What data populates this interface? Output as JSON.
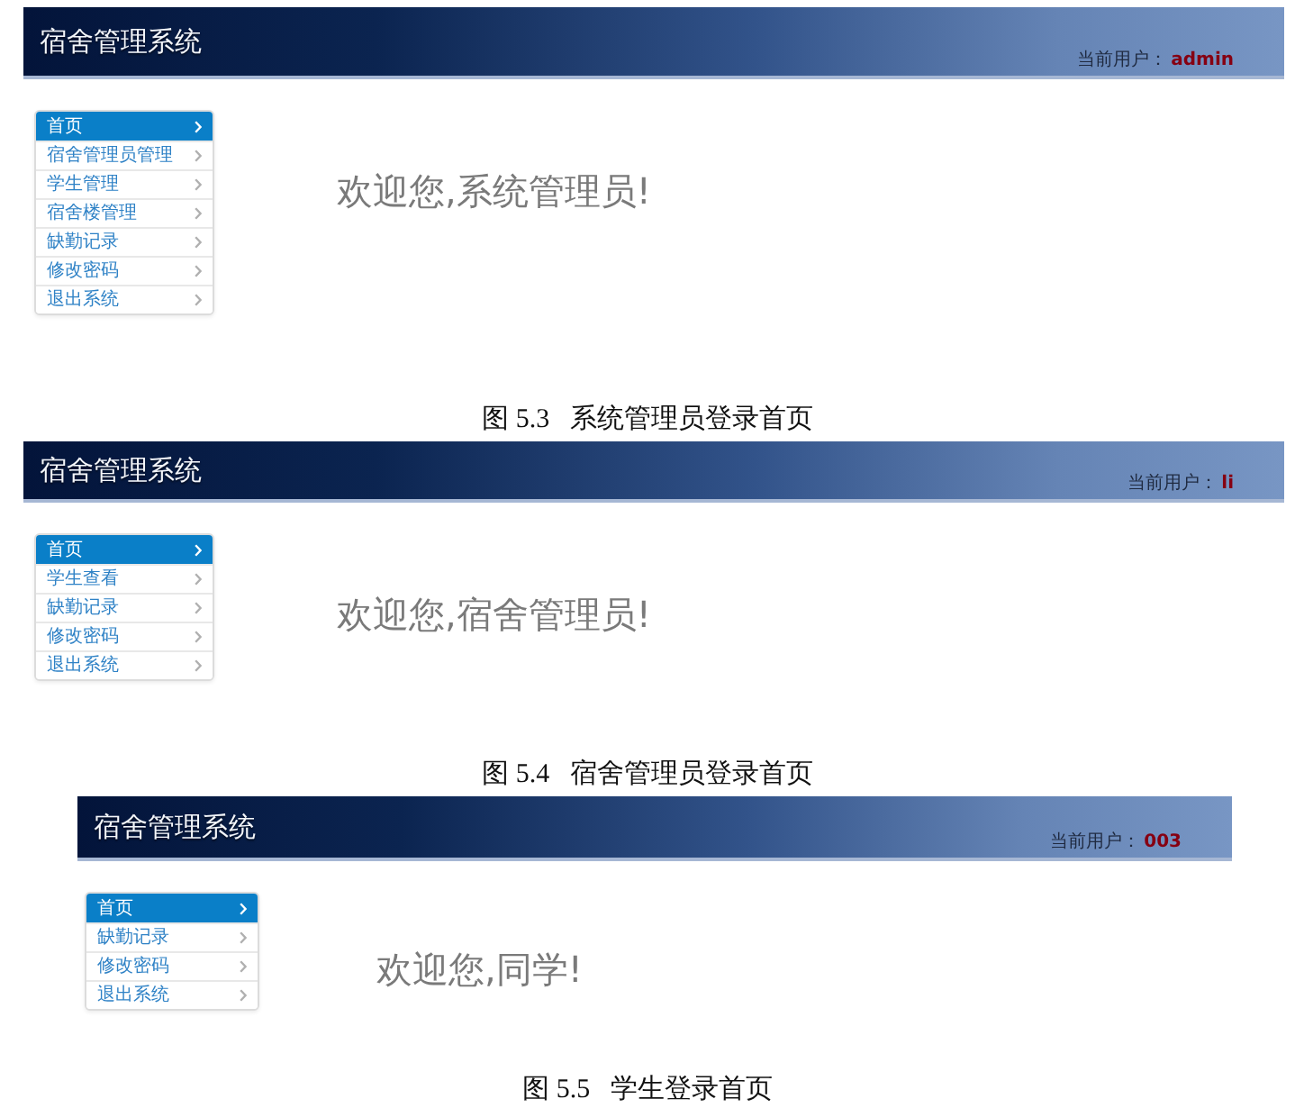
{
  "figures": [
    {
      "header": {
        "title": "宿舍管理系统",
        "user_label": "当前用户：",
        "user_name": "admin"
      },
      "menu": [
        {
          "label": "首页",
          "selected": true
        },
        {
          "label": "宿舍管理员管理",
          "selected": false
        },
        {
          "label": "学生管理",
          "selected": false
        },
        {
          "label": "宿舍楼管理",
          "selected": false
        },
        {
          "label": "缺勤记录",
          "selected": false
        },
        {
          "label": "修改密码",
          "selected": false
        },
        {
          "label": "退出系统",
          "selected": false
        }
      ],
      "welcome": "欢迎您,系统管理员!",
      "caption": "图 5.3   系统管理员登录首页"
    },
    {
      "header": {
        "title": "宿舍管理系统",
        "user_label": "当前用户：",
        "user_name": "li"
      },
      "menu": [
        {
          "label": "首页",
          "selected": true
        },
        {
          "label": "学生查看",
          "selected": false
        },
        {
          "label": "缺勤记录",
          "selected": false
        },
        {
          "label": "修改密码",
          "selected": false
        },
        {
          "label": "退出系统",
          "selected": false
        }
      ],
      "welcome": "欢迎您,宿舍管理员!",
      "caption": "图 5.4   宿舍管理员登录首页"
    },
    {
      "header": {
        "title": "宿舍管理系统",
        "user_label": "当前用户：",
        "user_name": "003"
      },
      "menu": [
        {
          "label": "首页",
          "selected": true
        },
        {
          "label": "缺勤记录",
          "selected": false
        },
        {
          "label": "修改密码",
          "selected": false
        },
        {
          "label": "退出系统",
          "selected": false
        }
      ],
      "welcome": "欢迎您,同学!",
      "caption": "图 5.5   学生登录首页"
    }
  ]
}
